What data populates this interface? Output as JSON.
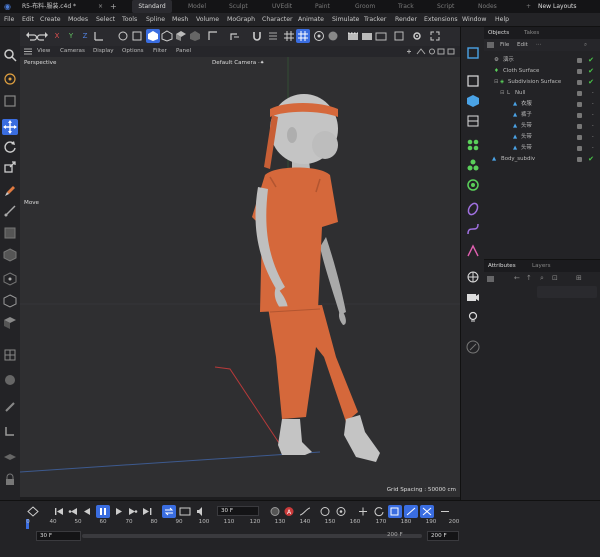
{
  "titlebar": {
    "document": "R5-布料-服装.c4d *",
    "close": "×",
    "new_tab": "+",
    "layouts": [
      "Standard",
      "Model",
      "Sculpt",
      "UVEdit",
      "Paint",
      "Groom",
      "Track",
      "Script",
      "Nodes"
    ],
    "new_layouts": "New Layouts"
  },
  "menubar": [
    "File",
    "Edit",
    "Create",
    "Modes",
    "Select",
    "Tools",
    "Spline",
    "Mesh",
    "Volume",
    "MoGraph",
    "Character",
    "Animate",
    "Simulate",
    "Tracker",
    "Render",
    "Extensions",
    "Window",
    "Help"
  ],
  "toolbar": {
    "axes": [
      "X",
      "Y",
      "Z"
    ]
  },
  "viewport": {
    "menu": [
      "View",
      "Cameras",
      "Display",
      "Options",
      "Filter",
      "Panel"
    ],
    "projection": "Perspective",
    "camera": "Default Camera ·⁕",
    "tool": "Move",
    "grid_spacing": "Grid Spacing : 50000 cm"
  },
  "objects_panel": {
    "tabs": [
      "Objects",
      "Takes"
    ],
    "menu": [
      "File",
      "Edit"
    ],
    "rows": [
      {
        "name": "演示",
        "indent": 0
      },
      {
        "name": "Cloth Surface",
        "indent": 0
      },
      {
        "name": "Subdivision Surface",
        "indent": 1
      },
      {
        "name": "Null",
        "indent": 2
      },
      {
        "name": "衣服",
        "indent": 3
      },
      {
        "name": "裤子",
        "indent": 3
      },
      {
        "name": "头带",
        "indent": 3
      },
      {
        "name": "头带",
        "indent": 3
      },
      {
        "name": "头带",
        "indent": 3
      },
      {
        "name": "Body_subdiv",
        "indent": 0
      }
    ]
  },
  "attributes_panel": {
    "tabs": [
      "Attributes",
      "Layers"
    ]
  },
  "timeline": {
    "current_frame": "30 F",
    "ruler": [
      "0",
      "40",
      "50",
      "60",
      "70",
      "80",
      "90",
      "100",
      "110",
      "120",
      "130",
      "140",
      "150",
      "160",
      "170",
      "180",
      "190",
      "200"
    ],
    "start": "30 F",
    "end": "200 F",
    "end2": "200 F"
  },
  "colors": {
    "accent": "#3a6de0",
    "cloth": "#d5683b",
    "body": "#bfbfbf",
    "check": "#4ac94a"
  }
}
